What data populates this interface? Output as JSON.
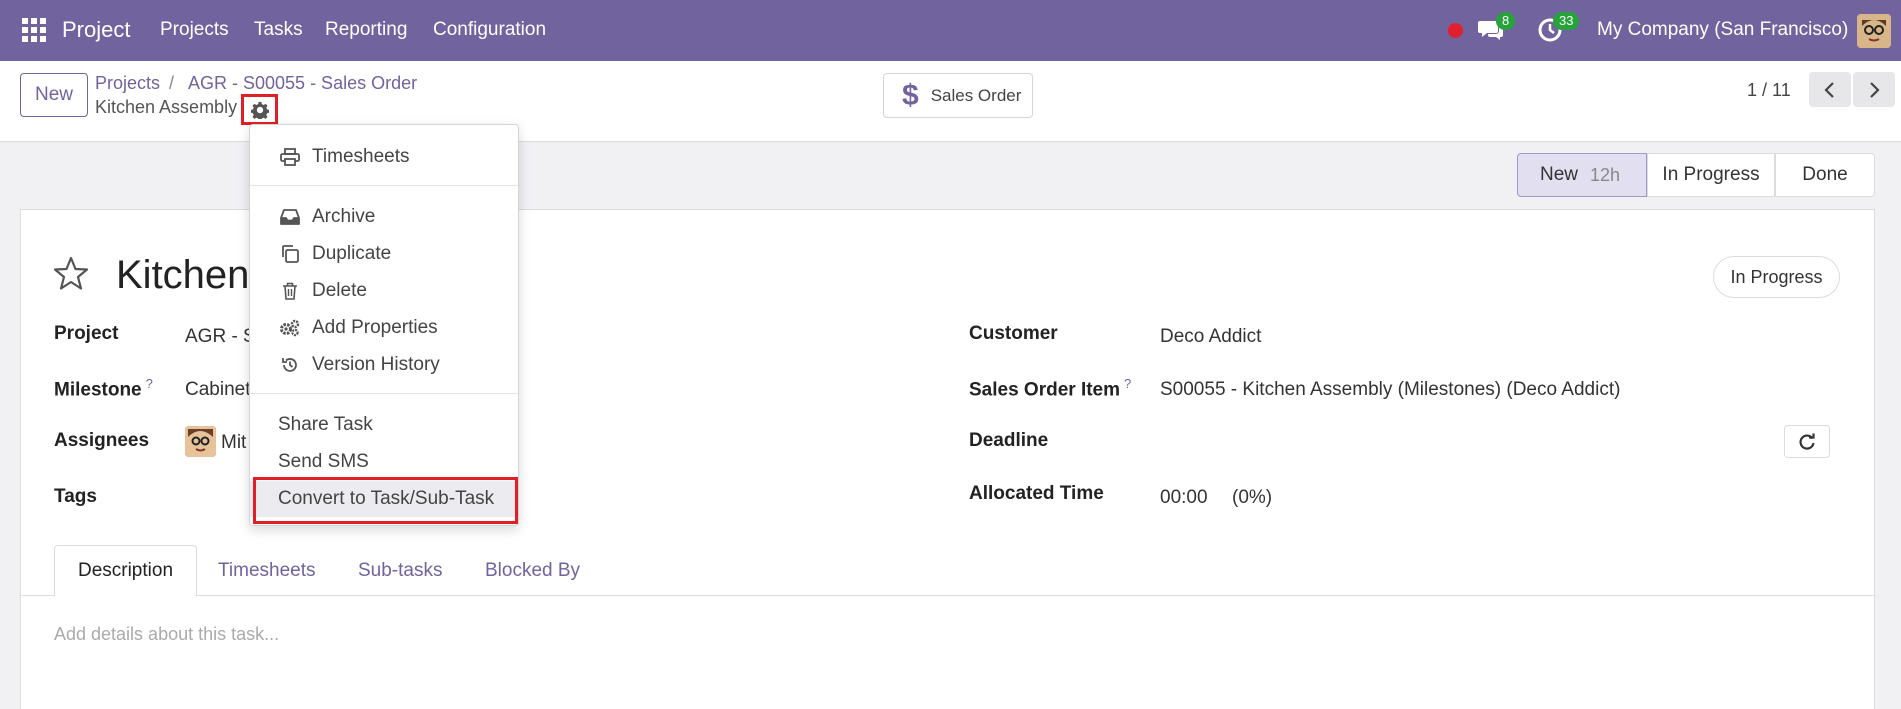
{
  "topbar": {
    "app_name": "Project",
    "menu": [
      "Projects",
      "Tasks",
      "Reporting",
      "Configuration"
    ],
    "messages_count": "8",
    "activities_count": "33",
    "company": "My Company (San Francisco)",
    "color": "#71639e"
  },
  "control": {
    "new_label": "New",
    "breadcrumb": [
      "Projects",
      "AGR - S00055 - Sales Order"
    ],
    "breadcrumb_sep": "/",
    "current": "Kitchen Assembly",
    "smart_button": "Sales Order",
    "smart_icon": "$",
    "pager": "1 / 11"
  },
  "statusbar": {
    "stages": [
      {
        "label": "New",
        "extra": "12h"
      },
      {
        "label": "In Progress"
      },
      {
        "label": "Done"
      }
    ]
  },
  "form": {
    "title_visible": "Kitchen",
    "state_pill": "In Progress",
    "fields_left": [
      {
        "label": "Project",
        "value": "AGR - S"
      },
      {
        "label": "Milestone",
        "help": "?",
        "value": "Cabinet"
      },
      {
        "label": "Assignees",
        "value": "Mit"
      },
      {
        "label": "Tags",
        "value": ""
      }
    ],
    "fields_right": [
      {
        "label": "Customer",
        "value": "Deco Addict"
      },
      {
        "label": "Sales Order Item",
        "help": "?",
        "value": "S00055 - Kitchen Assembly (Milestones) (Deco Addict)"
      },
      {
        "label": "Deadline",
        "value": ""
      },
      {
        "label": "Allocated Time",
        "value": "00:00",
        "extra": "(0%)"
      }
    ]
  },
  "tabs": [
    "Description",
    "Timesheets",
    "Sub-tasks",
    "Blocked By"
  ],
  "description_placeholder": "Add details about this task...",
  "dropdown": {
    "group1": [
      {
        "label": "Timesheets",
        "icon": "print-icon"
      }
    ],
    "group2": [
      {
        "label": "Archive",
        "icon": "inbox-icon"
      },
      {
        "label": "Duplicate",
        "icon": "copy-icon"
      },
      {
        "label": "Delete",
        "icon": "trash-icon"
      },
      {
        "label": "Add Properties",
        "icon": "cogs-icon"
      },
      {
        "label": "Version History",
        "icon": "history-icon"
      }
    ],
    "group3": [
      "Share Task",
      "Send SMS",
      "Convert to Task/Sub-Task"
    ]
  }
}
